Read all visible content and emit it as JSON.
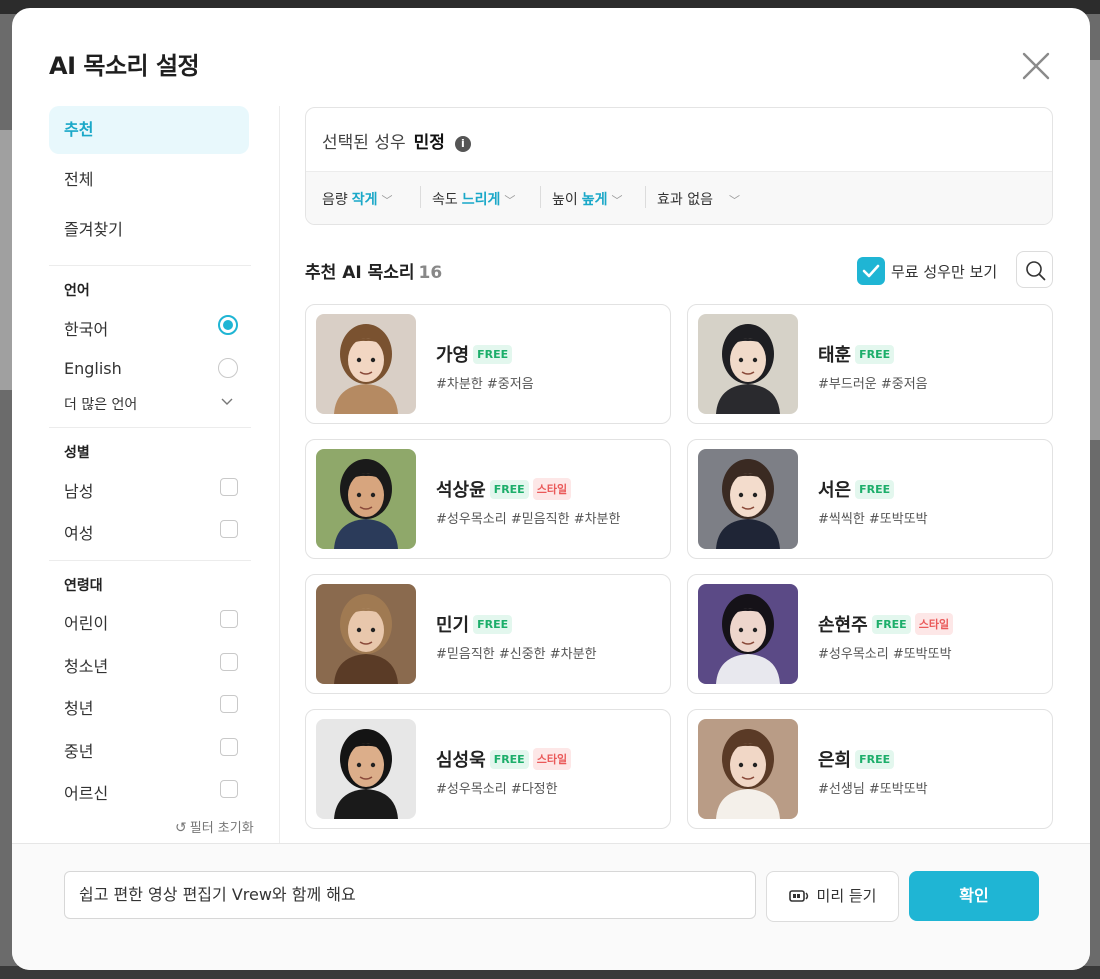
{
  "modal": {
    "title": "AI 목소리 설정"
  },
  "sidebar": {
    "tabs": [
      {
        "label": "추천",
        "active": true
      },
      {
        "label": "전체",
        "active": false
      },
      {
        "label": "즐겨찾기",
        "active": false
      }
    ],
    "language": {
      "heading": "언어",
      "options": [
        {
          "label": "한국어",
          "selected": true
        },
        {
          "label": "English",
          "selected": false
        }
      ],
      "more": "더 많은 언어"
    },
    "gender": {
      "heading": "성별",
      "options": [
        {
          "label": "남성"
        },
        {
          "label": "여성"
        }
      ]
    },
    "age": {
      "heading": "연령대",
      "options": [
        {
          "label": "어린이"
        },
        {
          "label": "청소년"
        },
        {
          "label": "청년"
        },
        {
          "label": "중년"
        },
        {
          "label": "어르신"
        }
      ]
    },
    "reset": "필터 초기화"
  },
  "selected": {
    "label": "선택된 성우",
    "name": "민정",
    "params": [
      {
        "label": "음량",
        "value": "작게"
      },
      {
        "label": "속도",
        "value": "느리게"
      },
      {
        "label": "높이",
        "value": "높게"
      },
      {
        "label": "효과 없음",
        "value": ""
      }
    ]
  },
  "list": {
    "title": "추천 AI 목소리",
    "count": "16",
    "free_only_label": "무료 성우만 보기"
  },
  "voices": [
    {
      "name": "가영",
      "badges": [
        "FREE"
      ],
      "tags": "#차분한 #중저음",
      "palette": {
        "bg": "#d9cfc6",
        "hair": "#7a5230",
        "skin": "#f2d6c2",
        "cloth": "#b58a62"
      }
    },
    {
      "name": "태훈",
      "badges": [
        "FREE"
      ],
      "tags": "#부드러운 #중저음",
      "palette": {
        "bg": "#d6d2c8",
        "hair": "#1e1e22",
        "skin": "#f1dac9",
        "cloth": "#2a2a2e"
      }
    },
    {
      "name": "석상윤",
      "badges": [
        "FREE",
        "스타일"
      ],
      "tags": "#성우목소리 #믿음직한 #차분한",
      "palette": {
        "bg": "#8fa86a",
        "hair": "#1a1a1a",
        "skin": "#d7a57e",
        "cloth": "#2b3b5a"
      }
    },
    {
      "name": "서은",
      "badges": [
        "FREE"
      ],
      "tags": "#씩씩한 #또박또박",
      "palette": {
        "bg": "#7d7f86",
        "hair": "#3a2a22",
        "skin": "#f3dccc",
        "cloth": "#1f2536"
      }
    },
    {
      "name": "민기",
      "badges": [
        "FREE"
      ],
      "tags": "#믿음직한 #신중한 #차분한",
      "palette": {
        "bg": "#8a6a4e",
        "hair": "#a07a52",
        "skin": "#e8c7ac",
        "cloth": "#5a3b26"
      }
    },
    {
      "name": "손현주",
      "badges": [
        "FREE",
        "스타일"
      ],
      "tags": "#성우목소리 #또박또박",
      "palette": {
        "bg": "#5b4a86",
        "hair": "#151218",
        "skin": "#eed6cc",
        "cloth": "#e8e8ee"
      }
    },
    {
      "name": "심성욱",
      "badges": [
        "FREE",
        "스타일"
      ],
      "tags": "#성우목소리 #다정한",
      "palette": {
        "bg": "#e7e7e7",
        "hair": "#141414",
        "skin": "#dcae8a",
        "cloth": "#1a1a1a"
      }
    },
    {
      "name": "은희",
      "badges": [
        "FREE"
      ],
      "tags": "#선생님 #또박또박",
      "palette": {
        "bg": "#b99c86",
        "hair": "#5a3a26",
        "skin": "#f1d7c6",
        "cloth": "#f4f0ea"
      }
    }
  ],
  "footer": {
    "input_value": "쉽고 편한 영상 편집기 Vrew와 함께 해요",
    "preview_label": "미리 듣기",
    "confirm_label": "확인"
  },
  "colors": {
    "accent": "#1fb5d4",
    "free_badge": "#1cae6a",
    "style_badge": "#ea5a5a"
  }
}
